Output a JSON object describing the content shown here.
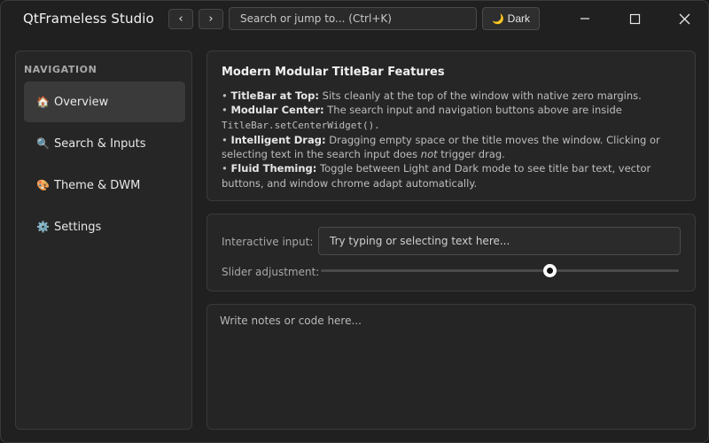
{
  "titlebar": {
    "app_title": "QtFrameless Studio",
    "back_label": "‹",
    "forward_label": "›",
    "search_placeholder": "Search or jump to... (Ctrl+K)",
    "theme_button": {
      "icon": "moon-icon",
      "glyph": "🌙",
      "label": "Dark"
    },
    "window_controls": [
      "minimize",
      "maximize",
      "close"
    ]
  },
  "sidebar": {
    "heading": "NAVIGATION",
    "items": [
      {
        "label": "Overview",
        "icon": "house-icon",
        "glyph": "🏠",
        "active": true
      },
      {
        "label": "Search & Inputs",
        "icon": "magnifier-icon",
        "glyph": "🔍",
        "active": false
      },
      {
        "label": "Theme & DWM",
        "icon": "palette-icon",
        "glyph": "🎨",
        "active": false
      },
      {
        "label": "Settings",
        "icon": "gear-icon",
        "glyph": "⚙️",
        "active": false
      }
    ]
  },
  "info": {
    "title": "Modern Modular TitleBar Features",
    "b1_bold": "TitleBar at Top:",
    "b1_text": " Sits cleanly at the top of the window with native zero margins.",
    "b2_bold": "Modular Center:",
    "b2_text": " The search input and navigation buttons above are inside",
    "b2_code": "TitleBar.setCenterWidget().",
    "b3_bold": "Intelligent Drag:",
    "b3_text_a": " Dragging empty space or the title moves the window. Clicking or selecting text in the search input does ",
    "b3_em": "not",
    "b3_text_b": " trigger drag.",
    "b4_bold": "Fluid Theming:",
    "b4_text": " Toggle between Light and Dark mode to see title bar text, vector buttons, and window chrome adapt automatically."
  },
  "controls": {
    "input_label": "Interactive input:",
    "input_placeholder": "Try typing or selecting text here...",
    "slider_label": "Slider adjustment:",
    "slider_value": 0.64
  },
  "notes": {
    "placeholder": "Write notes or code here..."
  },
  "colors": {
    "window_bg": "#202020",
    "panel_bg": "#262626",
    "active_item_bg": "#3a3a3a",
    "border": "#3a3a3a"
  }
}
